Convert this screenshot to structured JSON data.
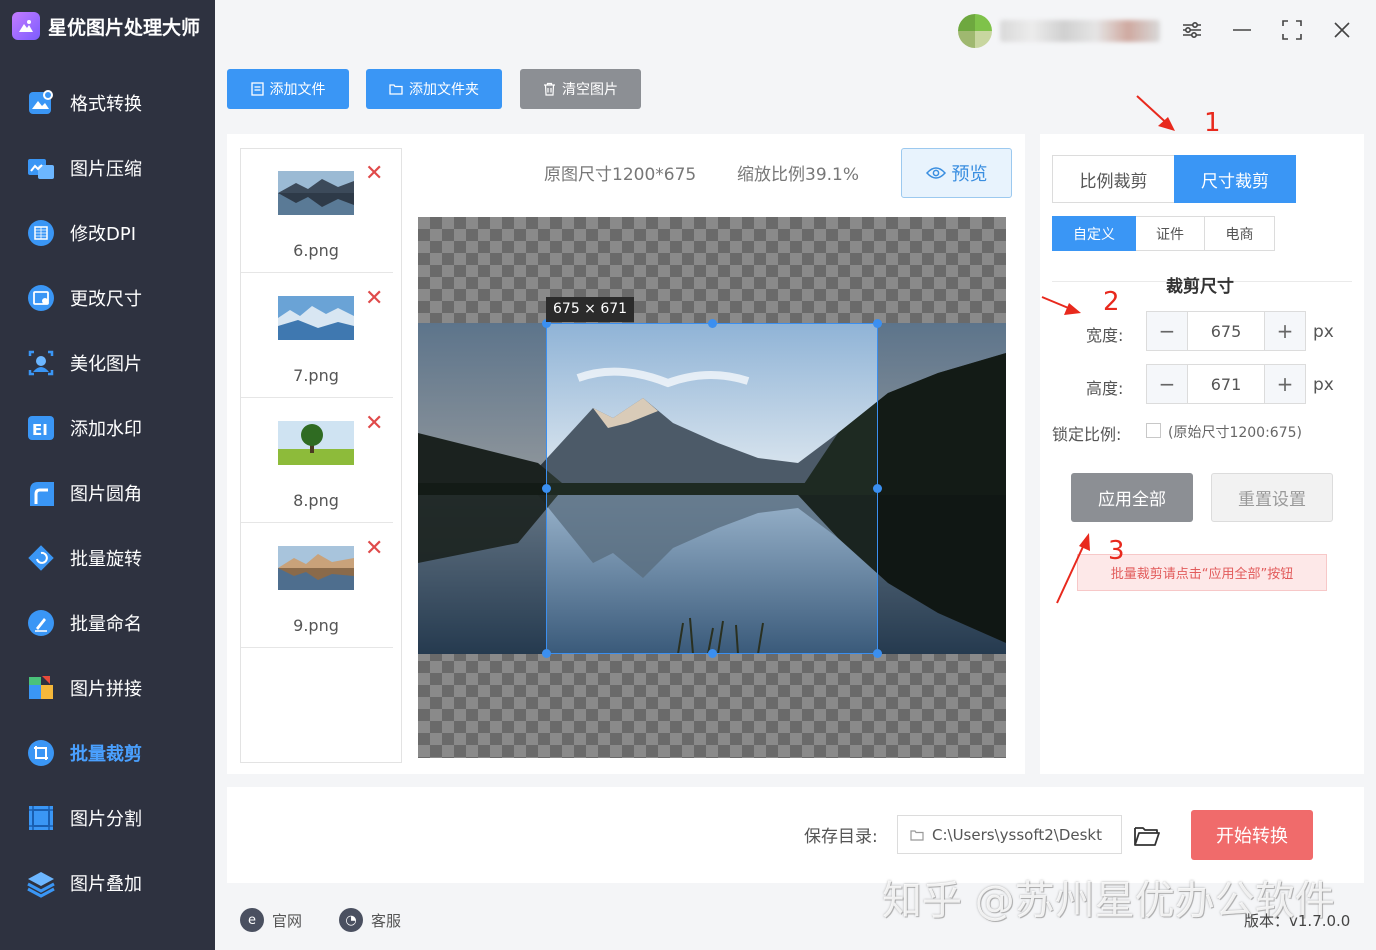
{
  "app": {
    "title": "星优图片处理大师"
  },
  "sidebar": {
    "items": [
      {
        "label": "格式转换",
        "icon": "image-convert-icon",
        "active": false
      },
      {
        "label": "图片压缩",
        "icon": "compress-icon",
        "active": false
      },
      {
        "label": "修改DPI",
        "icon": "dpi-icon",
        "active": false
      },
      {
        "label": "更改尺寸",
        "icon": "resize-icon",
        "active": false
      },
      {
        "label": "美化图片",
        "icon": "beautify-icon",
        "active": false
      },
      {
        "label": "添加水印",
        "icon": "watermark-icon",
        "active": false
      },
      {
        "label": "图片圆角",
        "icon": "rounded-corner-icon",
        "active": false
      },
      {
        "label": "批量旋转",
        "icon": "rotate-icon",
        "active": false
      },
      {
        "label": "批量命名",
        "icon": "rename-icon",
        "active": false
      },
      {
        "label": "图片拼接",
        "icon": "puzzle-icon",
        "active": false
      },
      {
        "label": "批量裁剪",
        "icon": "crop-icon",
        "active": true
      },
      {
        "label": "图片分割",
        "icon": "split-icon",
        "active": false
      },
      {
        "label": "图片叠加",
        "icon": "layers-icon",
        "active": false
      }
    ]
  },
  "toolbar": {
    "add_file": "添加文件",
    "add_folder": "添加文件夹",
    "clear_images": "清空图片"
  },
  "files": [
    {
      "name": "6.png"
    },
    {
      "name": "7.png"
    },
    {
      "name": "8.png"
    },
    {
      "name": "9.png"
    }
  ],
  "preview": {
    "original_size": "原图尺寸1200*675",
    "zoom_ratio": "缩放比例39.1%",
    "preview_label": "预览",
    "crop_size_label": "675 × 671"
  },
  "crop_settings": {
    "mode_ratio": "比例裁剪",
    "mode_size": "尺寸裁剪",
    "sub_tabs": [
      "自定义",
      "证件",
      "电商"
    ],
    "section_title": "裁剪尺寸",
    "width_label": "宽度:",
    "width_value": "675",
    "height_label": "高度:",
    "height_value": "671",
    "unit": "px",
    "lock_label": "锁定比例:",
    "lock_hint": "(原始尺寸1200:675)",
    "apply_all": "应用全部",
    "reset": "重置设置",
    "tip": "批量裁剪请点击“应用全部”按钮"
  },
  "annotations": [
    "1",
    "2",
    "3"
  ],
  "bottom": {
    "save_label": "保存目录:",
    "save_path": "C:\\Users\\yssoft2\\Deskt",
    "start_button": "开始转换"
  },
  "footer": {
    "website": "官网",
    "support": "客服",
    "version": "版本：v1.7.0.0"
  },
  "watermark": "知乎 @苏州星优办公软件",
  "colors": {
    "sidebar_bg": "#2e3240",
    "accent_blue": "#3a96f5",
    "start_red": "#f06b6b",
    "annotation_red": "#e8291d"
  }
}
